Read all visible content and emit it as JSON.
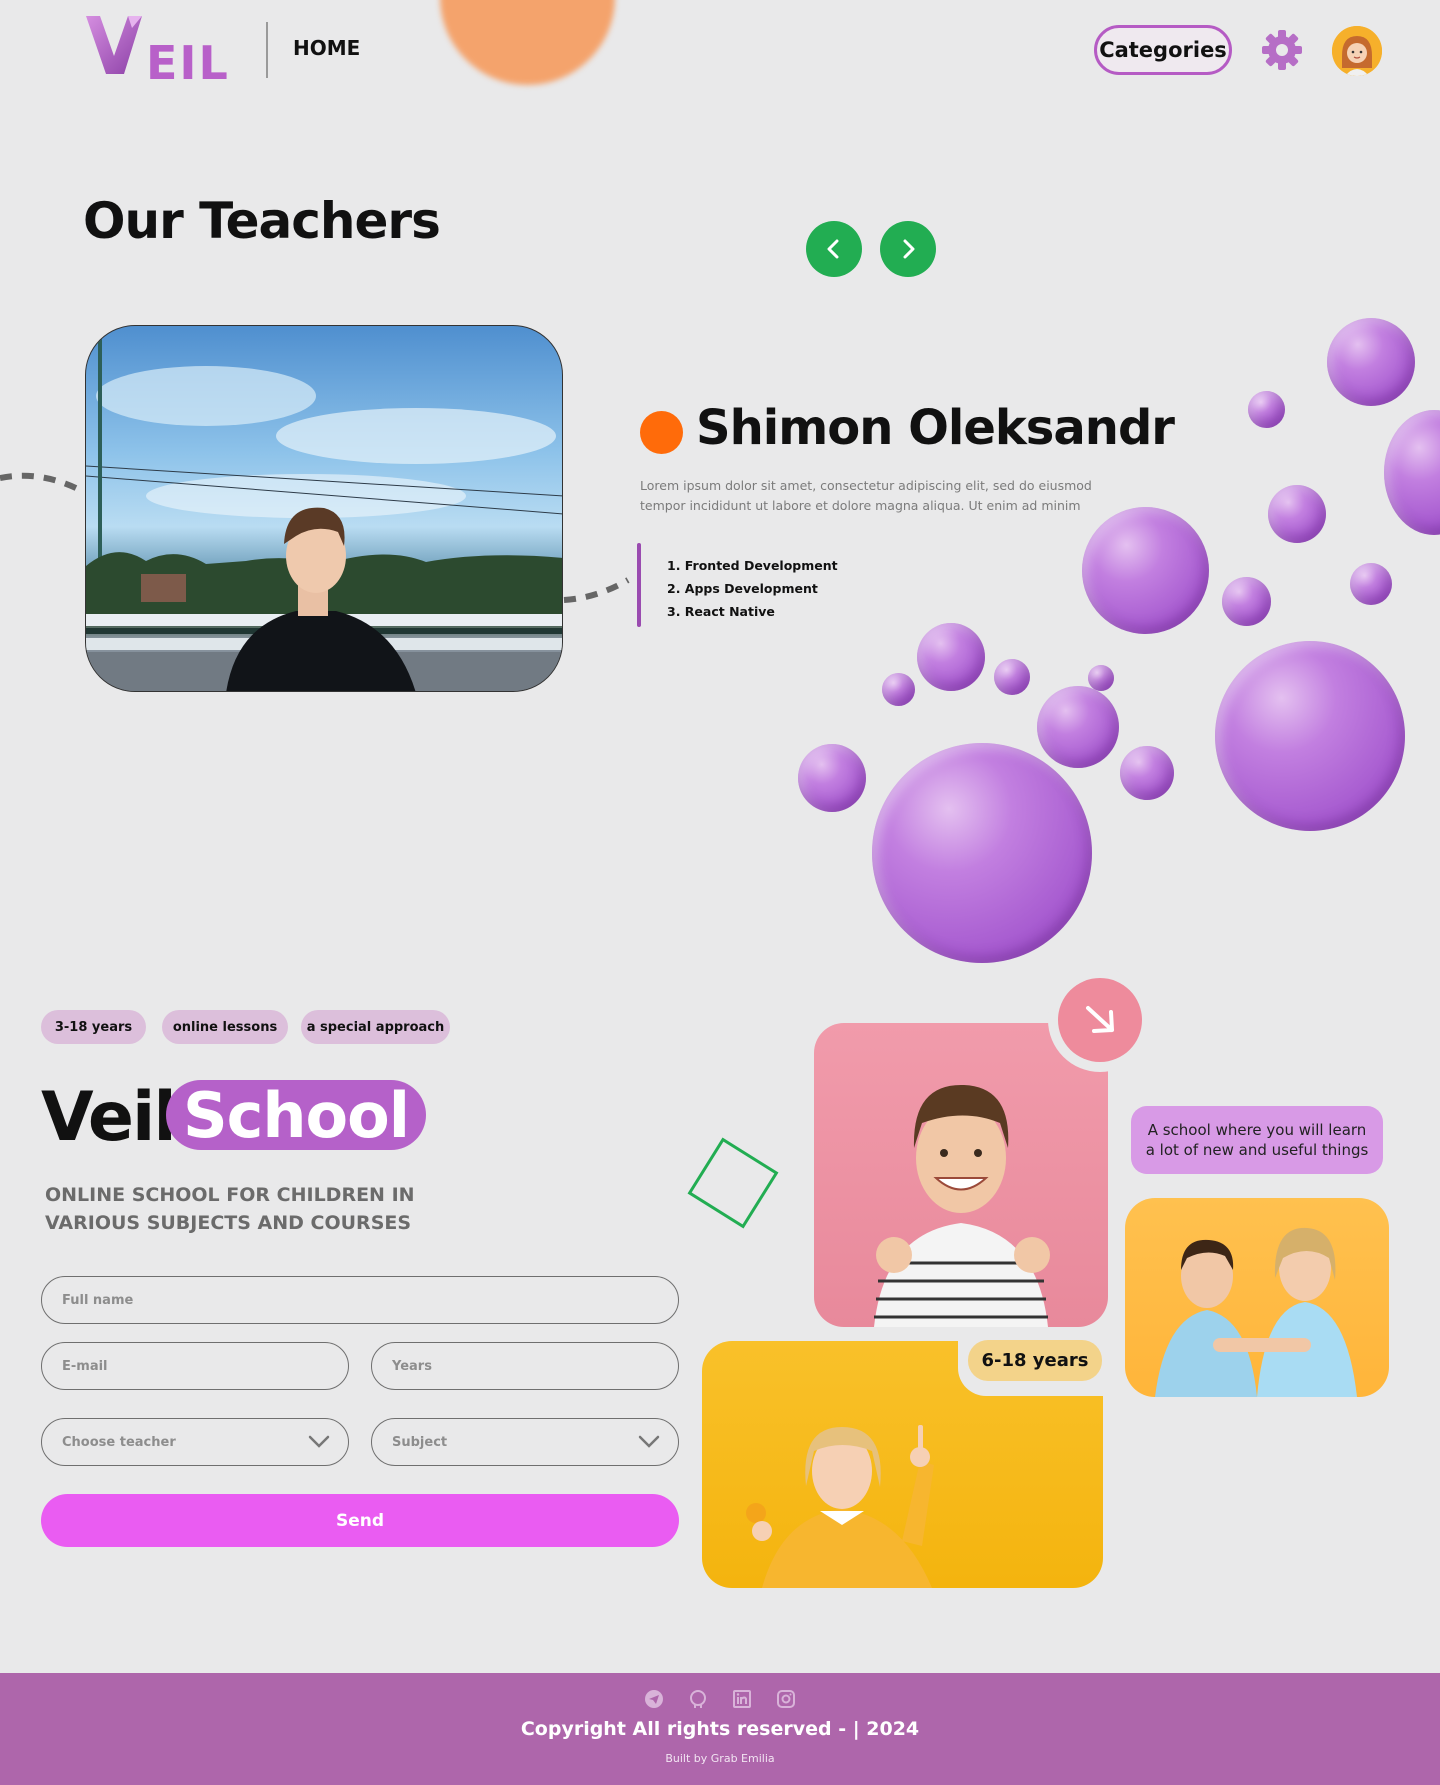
{
  "header": {
    "logo_text": "EIL",
    "nav_home": "HOME",
    "categories_label": "Categories"
  },
  "teachers": {
    "title": "Our Teachers",
    "teacher": {
      "name": "Shimon Oleksandr",
      "description": "Lorem ipsum dolor sit amet, consectetur adipiscing elit, sed do eiusmod tempor incididunt ut labore et dolore magna aliqua. Ut enim ad minim",
      "skills": [
        "1. Fronted Development",
        "2. Apps Development",
        "3. React Native"
      ]
    }
  },
  "school": {
    "tags": [
      "3-18 years",
      "online lessons",
      "a special approach"
    ],
    "title_word": "Veil",
    "title_pill": "School",
    "subtitle": "ONLINE SCHOOL FOR CHILDREN IN VARIOUS SUBJECTS AND COURSES",
    "form": {
      "full_name_placeholder": "Full name",
      "email_placeholder": "E-mail",
      "years_placeholder": "Years",
      "teacher_select": "Choose teacher",
      "subject_select": "Subject",
      "send_label": "Send"
    },
    "speech_bubble": "A school where you will learn a lot of new and useful things",
    "age_badge": "6-18 years"
  },
  "footer": {
    "social_icons": [
      "telegram-icon",
      "github-icon",
      "linkedin-icon",
      "instagram-icon"
    ],
    "copyright": "Copyright All rights reserved - | 2024",
    "built_by": "Built by Grab Emilia"
  },
  "colors": {
    "accent_purple": "#b561c9",
    "green": "#22ad52",
    "orange": "#ff6b0a",
    "send_pink": "#ea5cf2",
    "footer": "#ae66ab"
  }
}
